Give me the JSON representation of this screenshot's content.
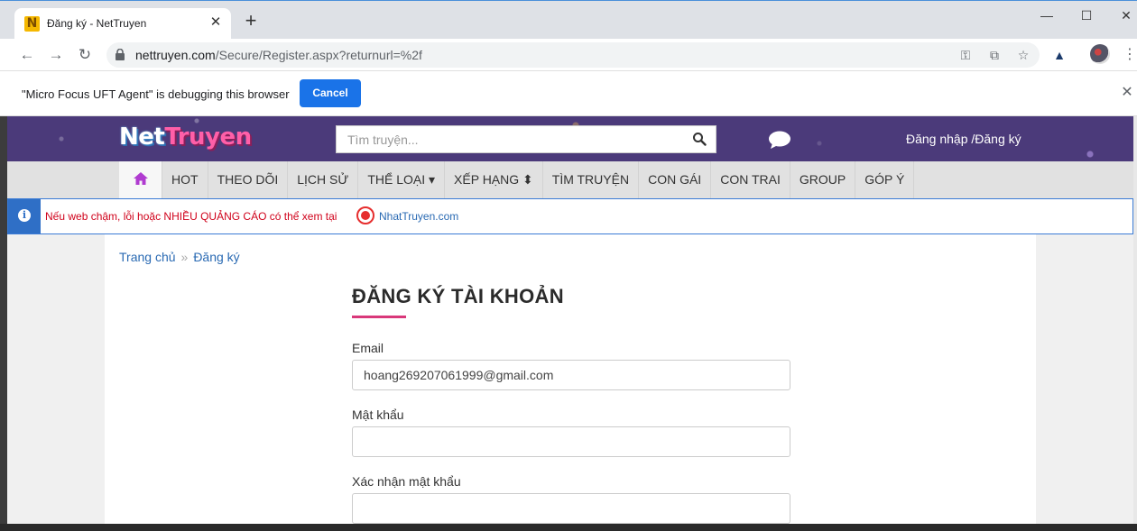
{
  "browser": {
    "tab_title": "Đăng ký - NetTruyen",
    "favicon_letter": "N",
    "new_tab": "+",
    "url_host": "nettruyen.com",
    "url_path": "/Secure/Register.aspx?returnurl=%2f",
    "window_controls": [
      "minimize-icon",
      "maximize-icon",
      "close-icon"
    ],
    "infobar_text": "\"Micro Focus UFT Agent\" is debugging this browser",
    "infobar_button": "Cancel"
  },
  "site": {
    "logo_net": "Net",
    "logo_truyen": "Truyen",
    "search_placeholder": "Tìm truyện...",
    "login_link": "Đăng nhập /Đăng ký",
    "nav": {
      "items": [
        "HOT",
        "THEO DÕI",
        "LỊCH SỬ",
        "THỂ LOẠI ▾",
        "XẾP HẠNG ⬍",
        "TÌM TRUYỆN",
        "CON GÁI",
        "CON TRAI",
        "GROUP",
        "GÓP Ý"
      ]
    },
    "notice": {
      "text": "Nếu web chậm, lỗi hoặc NHIỀU QUẢNG CÁO có thể xem tại",
      "link": "NhatTruyen.com"
    }
  },
  "breadcrumb": {
    "home": "Trang chủ",
    "separator": "»",
    "current": "Đăng ký"
  },
  "form": {
    "title": "ĐĂNG KÝ TÀI KHOẢN",
    "email_label": "Email",
    "email_value": "hoang269207061999@gmail.com",
    "password_label": "Mật khẩu",
    "password_value": "",
    "confirm_label": "Xác nhận mật khẩu",
    "confirm_value": ""
  },
  "colors": {
    "header_bg": "#4b3a7a",
    "accent_pink": "#d9387a",
    "link_blue": "#2a6ab3",
    "notice_red": "#d0021b",
    "chrome_blue": "#1a73e8"
  }
}
